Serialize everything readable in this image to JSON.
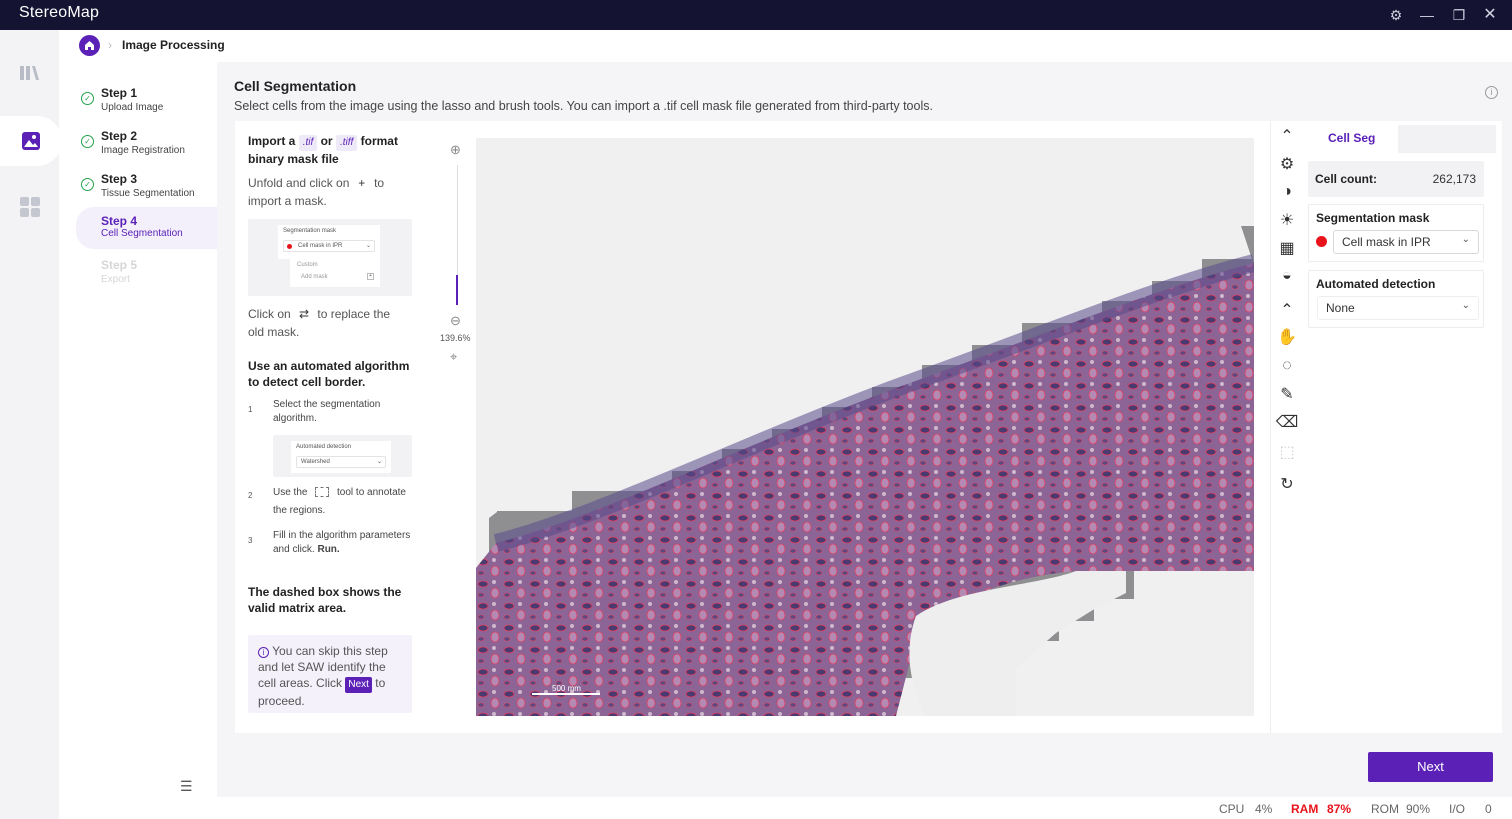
{
  "app": {
    "title": "StereoMap"
  },
  "breadcrumb": {
    "page": "Image Processing"
  },
  "steps": [
    {
      "title": "Step 1",
      "subtitle": "Upload Image",
      "state": "done"
    },
    {
      "title": "Step 2",
      "subtitle": "Image Registration",
      "state": "done"
    },
    {
      "title": "Step 3",
      "subtitle": "Tissue Segmentation",
      "state": "done"
    },
    {
      "title": "Step 4",
      "subtitle": "Cell Segmentation",
      "state": "current"
    },
    {
      "title": "Step 5",
      "subtitle": "Export",
      "state": "disabled"
    }
  ],
  "page": {
    "title": "Cell Segmentation",
    "description": "Select cells from the image using the lasso and brush tools. You can import a .tif cell mask file generated from third-party tools."
  },
  "guide": {
    "import_a": "Import a",
    "ext_tif": ".tif",
    "or": "or",
    "ext_tiff": ".tiff",
    "format": "format",
    "binary": "binary mask file",
    "unfold_a": "Unfold and click on",
    "plus": "+",
    "unfold_b": "to",
    "unfold_c": "import a mask.",
    "mini1": {
      "title": "Segmentation mask",
      "item": "Cell mask in IPR",
      "custom": "Custom",
      "add": "Add mask"
    },
    "replace_a": "Click on",
    "replace_icon": "⇄",
    "replace_b": "to replace the",
    "replace_c": "old mask.",
    "auto_heading_1": "Use an automated algorithm",
    "auto_heading_2": "to detect cell border.",
    "s1_num": "1",
    "s1_text": "Select the segmentation algorithm.",
    "mini2": {
      "title": "Automated detection",
      "value": "Watershed"
    },
    "s2_num": "2",
    "s2_a": "Use the",
    "s2_b": "tool to annotate",
    "s2_c": "the regions.",
    "s3_num": "3",
    "s3_text": "Fill in the algorithm parameters and click.",
    "s3_run": "Run.",
    "dashed_1": "The dashed box shows the",
    "dashed_2": "valid matrix area.",
    "note_a": "You can skip this step and let SAW identify the cell areas. Click",
    "note_next": "Next",
    "note_b": "to proceed."
  },
  "viewer": {
    "zoom": "139.6%",
    "scalebar": "500 mm"
  },
  "right_panel": {
    "tab": "Cell Seg",
    "cell_count_label": "Cell count:",
    "cell_count_value": "262,173",
    "seg_mask_label": "Segmentation mask",
    "seg_mask_value": "Cell mask in IPR",
    "seg_mask_color": "#e8131b",
    "auto_label": "Automated detection",
    "auto_value": "None"
  },
  "footer": {
    "next": "Next"
  },
  "status": {
    "cpu_label": "CPU",
    "cpu": "4%",
    "ram_label": "RAM",
    "ram": "87%",
    "rom_label": "ROM",
    "rom": "90%",
    "io_label": "I/O",
    "io": "0"
  },
  "colors": {
    "accent": "#5b21b6",
    "titlebar": "#141432",
    "ram_alert": "#e8131b"
  }
}
